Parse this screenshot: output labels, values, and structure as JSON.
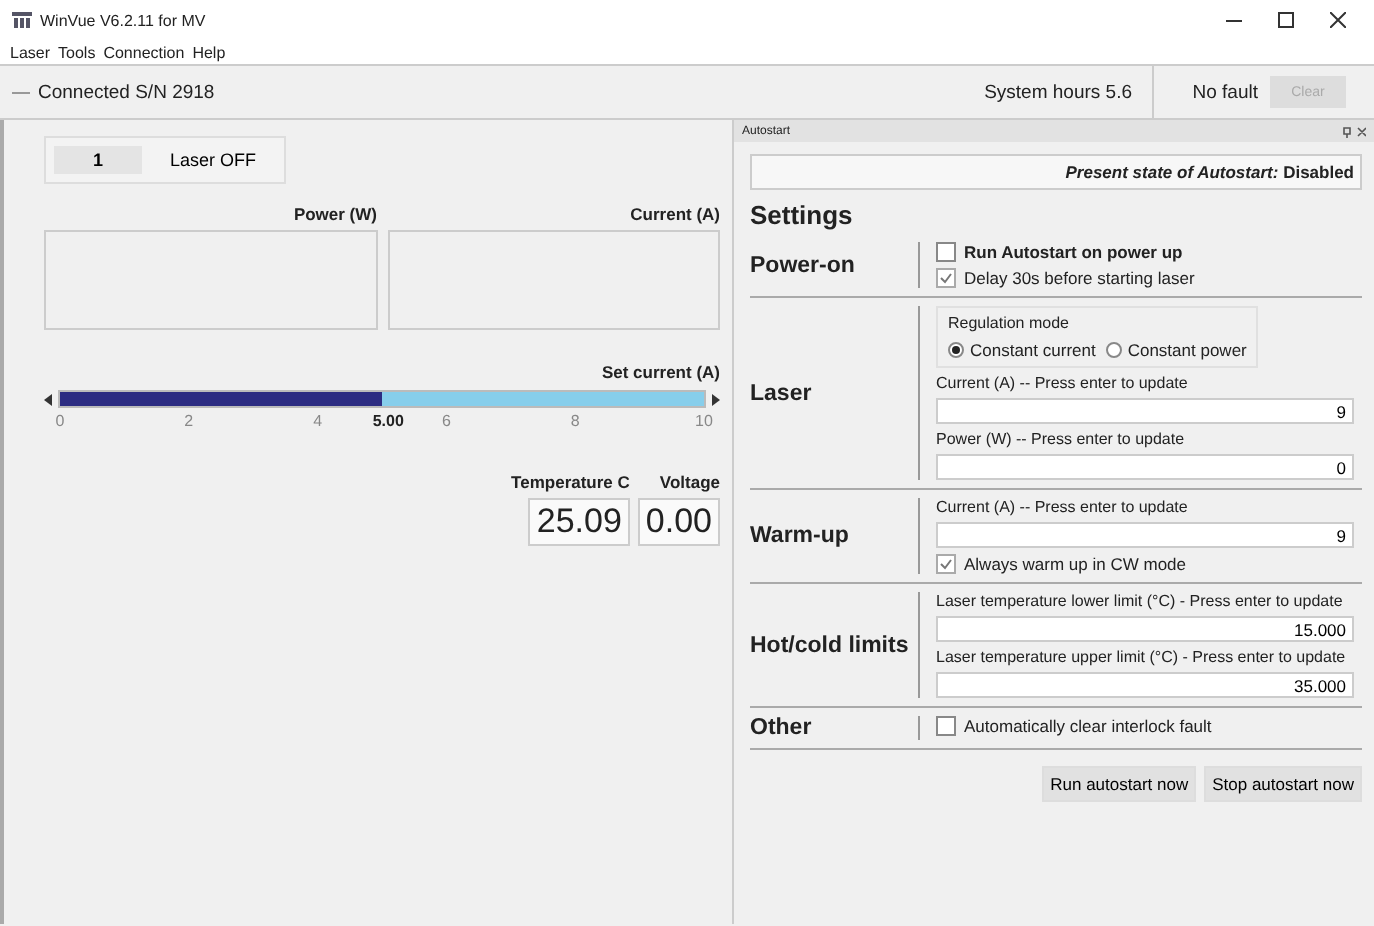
{
  "window": {
    "title": "WinVue V6.2.11 for MV"
  },
  "menu": [
    "Laser",
    "Tools",
    "Connection",
    "Help"
  ],
  "status_bar": {
    "connection": "Connected S/N 2918",
    "system_hours": "System hours 5.6",
    "fault": "No fault",
    "clear_button": {
      "label": "Clear",
      "disabled": true
    }
  },
  "laser_control": {
    "channel": "1",
    "status": "Laser OFF"
  },
  "readouts": [
    {
      "label": "Power (W)"
    },
    {
      "label": "Current (A)"
    }
  ],
  "set_current": {
    "label": "Set current (A)",
    "level": 0.5,
    "value": "5.00",
    "ticks": [
      "0",
      "2",
      "4",
      "6",
      "8",
      "10"
    ]
  },
  "meters": [
    {
      "label": "Temperature C",
      "value": "25.09"
    },
    {
      "label": "Voltage",
      "value": "0.00"
    }
  ],
  "autostart": {
    "panel_title": "Autostart",
    "present_state_label": "Present state of Autostart:",
    "present_state": "Disabled",
    "heading": "Settings",
    "sections": [
      {
        "title": "Power-on",
        "items": [
          {
            "kind": "checkbox",
            "label": "Run Autostart on power up",
            "checked": false,
            "bold": true
          },
          {
            "kind": "checkbox",
            "label": "Delay 30s before starting laser",
            "checked": true,
            "bold": false
          }
        ]
      },
      {
        "title": "Laser",
        "items": [
          {
            "kind": "radio-group",
            "label": "Regulation mode",
            "options": [
              {
                "label": "Constant current",
                "selected": true
              },
              {
                "label": "Constant power",
                "selected": false
              }
            ]
          },
          {
            "kind": "field",
            "label": "Current (A) -- Press enter to update",
            "value": "9"
          },
          {
            "kind": "field",
            "label": "Power (W) -- Press enter to update",
            "value": "0"
          }
        ]
      },
      {
        "title": "Warm-up",
        "items": [
          {
            "kind": "field",
            "label": "Current (A) -- Press enter to update",
            "value": "9"
          },
          {
            "kind": "checkbox",
            "label": "Always warm up in CW mode",
            "checked": true,
            "bold": false
          }
        ]
      },
      {
        "title": "Hot/cold limits",
        "items": [
          {
            "kind": "field",
            "label": "Laser temperature lower limit (°C) - Press enter to update",
            "value": "15.000"
          },
          {
            "kind": "field",
            "label": "Laser temperature upper limit (°C) - Press enter to update",
            "value": "35.000"
          }
        ]
      },
      {
        "title": "Other",
        "items": [
          {
            "kind": "checkbox",
            "label": "Automatically clear interlock fault",
            "checked": false,
            "bold": false
          }
        ]
      }
    ],
    "buttons": [
      "Run autostart now",
      "Stop autostart now"
    ]
  }
}
